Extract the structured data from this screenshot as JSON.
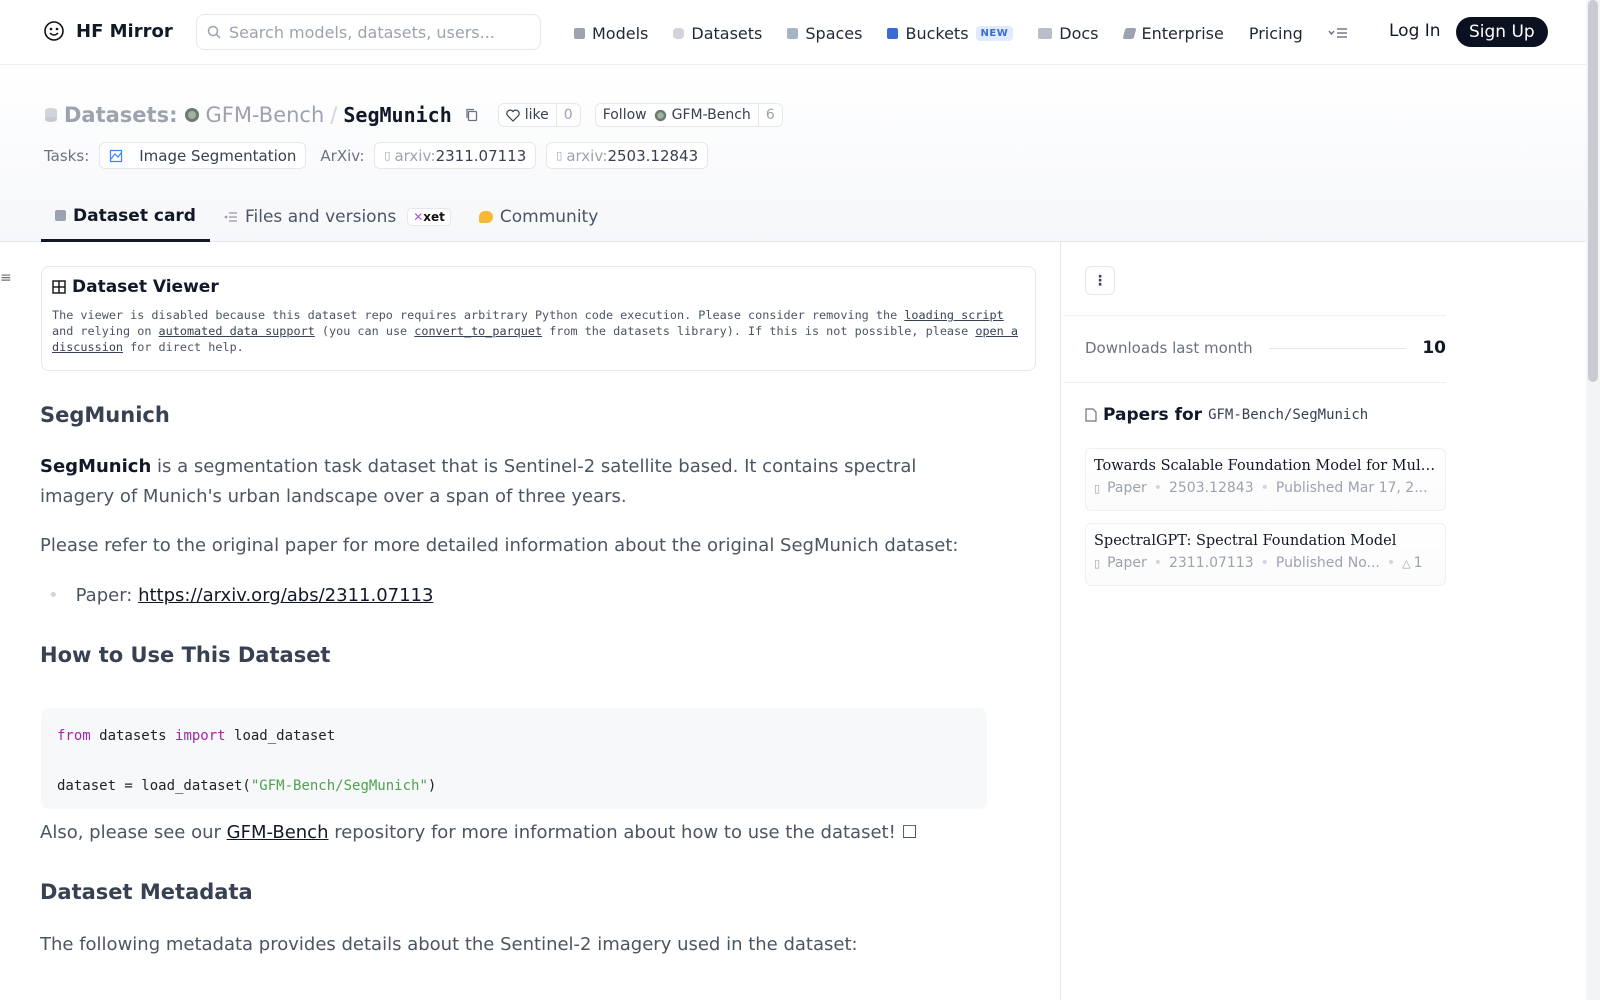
{
  "nav": {
    "brand": "HF Mirror",
    "search_placeholder": "Search models, datasets, users...",
    "links": [
      {
        "label": "Models",
        "icon": "cube-icon",
        "color": "#9ca3af"
      },
      {
        "label": "Datasets",
        "icon": "database-icon",
        "color": "#d1d5db"
      },
      {
        "label": "Spaces",
        "icon": "grid-icon",
        "color": "#a5b4c8"
      },
      {
        "label": "Buckets",
        "icon": "bucket-icon",
        "color": "#3b6bd6",
        "badge": "NEW"
      },
      {
        "label": "Docs",
        "icon": "book-icon",
        "color": "#b8bec8"
      },
      {
        "label": "Enterprise",
        "icon": "enterprise-icon",
        "color": "#9ca3af"
      },
      {
        "label": "Pricing"
      }
    ],
    "login": "Log In",
    "signup": "Sign Up"
  },
  "header": {
    "type_label": "Datasets:",
    "org": "GFM-Bench",
    "separator": "/",
    "name": "SegMunich",
    "like_label": "like",
    "like_count": "0",
    "follow_label": "Follow",
    "follow_org": "GFM-Bench",
    "follow_count": "6",
    "tasks_label": "Tasks:",
    "task": "Image Segmentation",
    "arxiv_label": "ArXiv:",
    "arxiv": [
      {
        "prefix": "arxiv:",
        "id": "2311.07113"
      },
      {
        "prefix": "arxiv:",
        "id": "2503.12843"
      }
    ]
  },
  "tabs": [
    {
      "label": "Dataset card",
      "active": true
    },
    {
      "label": "Files and versions",
      "badge": "xet"
    },
    {
      "label": "Community"
    }
  ],
  "viewer": {
    "title": "Dataset Viewer",
    "text1": "The viewer is disabled because this dataset repo requires arbitrary Python code execution. Please consider removing the ",
    "link1": "loading script",
    "text2": " and relying on ",
    "link2": "automated data support",
    "text3": " (you can use ",
    "link3": "convert_to_parquet",
    "text4": " from the datasets library). If this is not possible, please ",
    "link4": "open a discussion",
    "text5": " for direct help."
  },
  "card": {
    "h_segmunich": "SegMunich",
    "intro_bold": "SegMunich",
    "intro_rest": " is a segmentation task dataset that is Sentinel-2 satellite based. It contains spectral imagery of Munich's urban landscape over a span of three years.",
    "refer": "Please refer to the original paper for more detailed information about the original SegMunich dataset:",
    "paper_label": "Paper: ",
    "paper_url": "https://arxiv.org/abs/2311.07113",
    "h_howto": "How to Use This Dataset",
    "code_kw1": "from",
    "code_mod": " datasets ",
    "code_kw2": "import",
    "code_fn": " load_dataset",
    "code_line2_a": "dataset = load_dataset(",
    "code_line2_str": "\"GFM-Bench/SegMunich\"",
    "code_line2_b": ")",
    "also_a": "Also, please see our ",
    "also_link": "GFM-Bench",
    "also_b": " repository for more information about how to use the dataset! ",
    "also_glyph": "☐",
    "h_meta": "Dataset Metadata",
    "meta_text": "The following metadata provides details about the Sentinel-2 imagery used in the dataset:"
  },
  "sidebar": {
    "menu_glyph": "⋮",
    "downloads_label": "Downloads last month",
    "downloads_value": "10",
    "papers_title": "Papers for",
    "papers_repo": "GFM-Bench/SegMunich",
    "papers": [
      {
        "title": "Towards Scalable Foundation Model for Multi-mo...",
        "kind": "Paper",
        "id": "2503.12843",
        "published": "Published Mar 17, 2..."
      },
      {
        "title": "SpectralGPT: Spectral Foundation Model",
        "kind": "Paper",
        "id": "2311.07113",
        "published": "Published No...",
        "upvotes": "1"
      }
    ]
  }
}
